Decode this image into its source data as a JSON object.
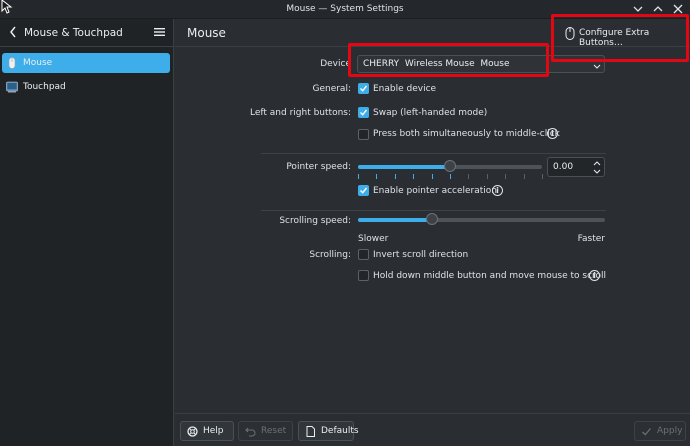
{
  "window": {
    "title": "Mouse — System Settings"
  },
  "sidebar": {
    "heading": "Mouse & Touchpad",
    "items": [
      {
        "label": "Mouse",
        "icon": "mouse-icon",
        "active": true
      },
      {
        "label": "Touchpad",
        "icon": "touchpad-icon",
        "active": false
      }
    ]
  },
  "main": {
    "heading": "Mouse",
    "configure_button": "Configure Extra Buttons…",
    "device": {
      "label": "Device",
      "value": "CHERRY  Wireless Mouse  Mouse"
    },
    "general": {
      "label": "General:",
      "enable_device": "Enable device",
      "enable_device_checked": true
    },
    "buttons": {
      "label": "Left and right buttons:",
      "swap": "Swap (left-handed mode)",
      "swap_checked": true,
      "middle_click": "Press both simultaneously to middle-click",
      "middle_click_checked": false
    },
    "pointer": {
      "label": "Pointer speed:",
      "value": "0.00",
      "slider_fraction": 0.5,
      "acceleration": "Enable pointer acceleration",
      "acceleration_checked": true
    },
    "scrolling_speed": {
      "label": "Scrolling speed:",
      "slider_fraction": 0.3,
      "min_label": "Slower",
      "max_label": "Faster"
    },
    "scrolling": {
      "label": "Scrolling:",
      "invert": "Invert scroll direction",
      "invert_checked": false,
      "middle_scroll": "Hold down middle button and move mouse to scroll",
      "middle_scroll_checked": false
    }
  },
  "footer": {
    "help": "Help",
    "reset": "Reset",
    "defaults": "Defaults",
    "apply": "Apply"
  },
  "colors": {
    "accent": "#3daee9",
    "highlight": "#e30613"
  }
}
